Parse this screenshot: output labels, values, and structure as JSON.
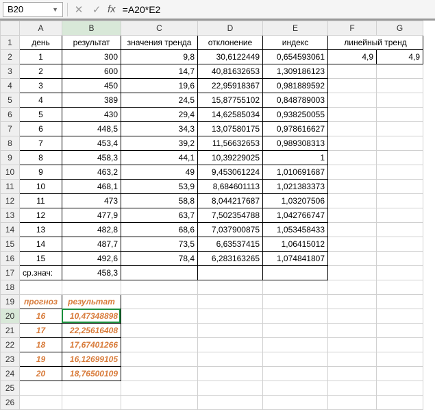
{
  "name_box": "B20",
  "formula": "=A20*E2",
  "fx_label": "fx",
  "columns": [
    "A",
    "B",
    "C",
    "D",
    "E",
    "F",
    "G"
  ],
  "row_count": 26,
  "headers": {
    "A": "день",
    "B": "результат",
    "C": "значения тренда",
    "D": "отклонение",
    "E": "индекс",
    "FG": "линейный тренд"
  },
  "data_rows": [
    {
      "A": "1",
      "B": "300",
      "C": "9,8",
      "D": "30,6122449",
      "E": "0,654593061",
      "F": "4,9",
      "G": "4,9"
    },
    {
      "A": "2",
      "B": "600",
      "C": "14,7",
      "D": "40,81632653",
      "E": "1,309186123"
    },
    {
      "A": "3",
      "B": "450",
      "C": "19,6",
      "D": "22,95918367",
      "E": "0,981889592"
    },
    {
      "A": "4",
      "B": "389",
      "C": "24,5",
      "D": "15,87755102",
      "E": "0,848789003"
    },
    {
      "A": "5",
      "B": "430",
      "C": "29,4",
      "D": "14,62585034",
      "E": "0,938250055"
    },
    {
      "A": "6",
      "B": "448,5",
      "C": "34,3",
      "D": "13,07580175",
      "E": "0,978616627"
    },
    {
      "A": "7",
      "B": "453,4",
      "C": "39,2",
      "D": "11,56632653",
      "E": "0,989308313"
    },
    {
      "A": "8",
      "B": "458,3",
      "C": "44,1",
      "D": "10,39229025",
      "E": "1"
    },
    {
      "A": "9",
      "B": "463,2",
      "C": "49",
      "D": "9,453061224",
      "E": "1,010691687"
    },
    {
      "A": "10",
      "B": "468,1",
      "C": "53,9",
      "D": "8,684601113",
      "E": "1,021383373"
    },
    {
      "A": "11",
      "B": "473",
      "C": "58,8",
      "D": "8,044217687",
      "E": "1,03207506"
    },
    {
      "A": "12",
      "B": "477,9",
      "C": "63,7",
      "D": "7,502354788",
      "E": "1,042766747"
    },
    {
      "A": "13",
      "B": "482,8",
      "C": "68,6",
      "D": "7,037900875",
      "E": "1,053458433"
    },
    {
      "A": "14",
      "B": "487,7",
      "C": "73,5",
      "D": "6,63537415",
      "E": "1,06415012"
    },
    {
      "A": "15",
      "B": "492,6",
      "C": "78,4",
      "D": "6,283163265",
      "E": "1,074841807"
    }
  ],
  "avg_row": {
    "label": "ср.знач:",
    "B": "458,3"
  },
  "prognoz": {
    "hdr_A": "прогноз",
    "hdr_B": "результат",
    "rows": [
      {
        "A": "16",
        "B": "10,47348898"
      },
      {
        "A": "17",
        "B": "22,25616408"
      },
      {
        "A": "18",
        "B": "17,67401266"
      },
      {
        "A": "19",
        "B": "16,12699105"
      },
      {
        "A": "20",
        "B": "18,76500109"
      }
    ]
  },
  "selection": {
    "row": 20,
    "col": "B"
  },
  "chart_data": {
    "type": "table",
    "title": "",
    "columns": [
      "день",
      "результат",
      "значения тренда",
      "отклонение",
      "индекс",
      "линейный тренд a",
      "линейный тренд b"
    ],
    "rows": [
      [
        1,
        300,
        9.8,
        30.6122449,
        0.654593061,
        4.9,
        4.9
      ],
      [
        2,
        600,
        14.7,
        40.81632653,
        1.309186123,
        null,
        null
      ],
      [
        3,
        450,
        19.6,
        22.95918367,
        0.981889592,
        null,
        null
      ],
      [
        4,
        389,
        24.5,
        15.87755102,
        0.848789003,
        null,
        null
      ],
      [
        5,
        430,
        29.4,
        14.62585034,
        0.938250055,
        null,
        null
      ],
      [
        6,
        448.5,
        34.3,
        13.07580175,
        0.978616627,
        null,
        null
      ],
      [
        7,
        453.4,
        39.2,
        11.56632653,
        0.989308313,
        null,
        null
      ],
      [
        8,
        458.3,
        44.1,
        10.39229025,
        1,
        null,
        null
      ],
      [
        9,
        463.2,
        49,
        9.453061224,
        1.010691687,
        null,
        null
      ],
      [
        10,
        468.1,
        53.9,
        8.684601113,
        1.021383373,
        null,
        null
      ],
      [
        11,
        473,
        58.8,
        8.044217687,
        1.03207506,
        null,
        null
      ],
      [
        12,
        477.9,
        63.7,
        7.502354788,
        1.042766747,
        null,
        null
      ],
      [
        13,
        482.8,
        68.6,
        7.037900875,
        1.053458433,
        null,
        null
      ],
      [
        14,
        487.7,
        73.5,
        6.63537415,
        1.06415012,
        null,
        null
      ],
      [
        15,
        492.6,
        78.4,
        6.283163265,
        1.074841807,
        null,
        null
      ]
    ],
    "average_row": [
      "ср.знач:",
      458.3,
      null,
      null,
      null,
      null,
      null
    ],
    "forecast": {
      "columns": [
        "прогноз",
        "результат"
      ],
      "rows": [
        [
          16,
          10.47348898
        ],
        [
          17,
          22.25616408
        ],
        [
          18,
          17.67401266
        ],
        [
          19,
          16.12699105
        ],
        [
          20,
          18.76500109
        ]
      ]
    }
  }
}
